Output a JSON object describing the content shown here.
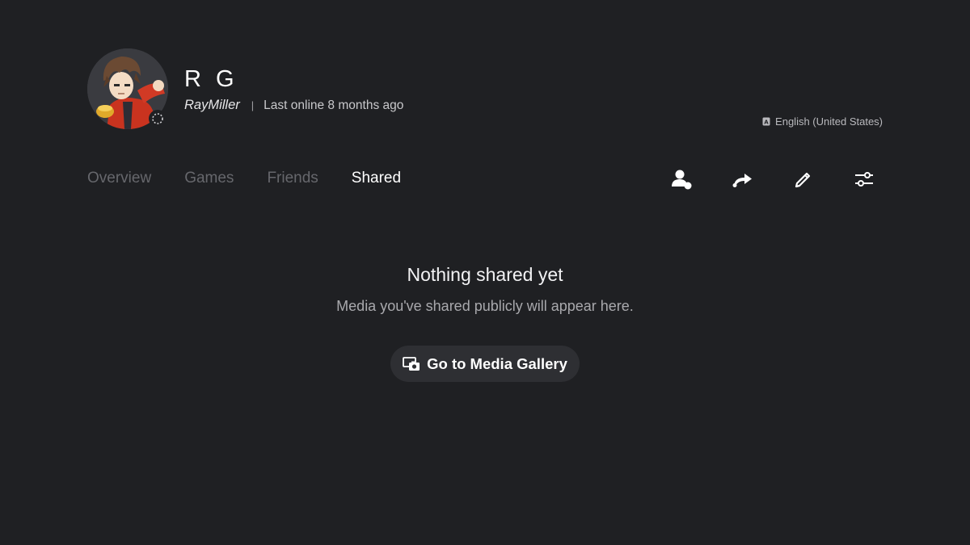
{
  "profile": {
    "display_name": "R G",
    "online_id": "RayMiller",
    "separator": "|",
    "last_online": "Last online 8 months ago",
    "language": "English (United States)",
    "avatar_icon": "anime-boy-avatar"
  },
  "tabs": [
    {
      "label": "Overview",
      "active": false
    },
    {
      "label": "Games",
      "active": false
    },
    {
      "label": "Friends",
      "active": false
    },
    {
      "label": "Shared",
      "active": true
    }
  ],
  "actions": {
    "icons": [
      "friend-request-icon",
      "share-icon",
      "edit-pencil-icon",
      "options-sliders-icon"
    ]
  },
  "empty_state": {
    "title": "Nothing shared yet",
    "subtitle": "Media you've shared publicly will appear here.",
    "button_label": "Go to Media Gallery",
    "button_icon": "media-gallery-icon"
  },
  "colors": {
    "background": "#1f2023",
    "inactive_tab": "#66676c",
    "button_bg": "#2e2f33",
    "accent_red": "#d73a2a"
  }
}
